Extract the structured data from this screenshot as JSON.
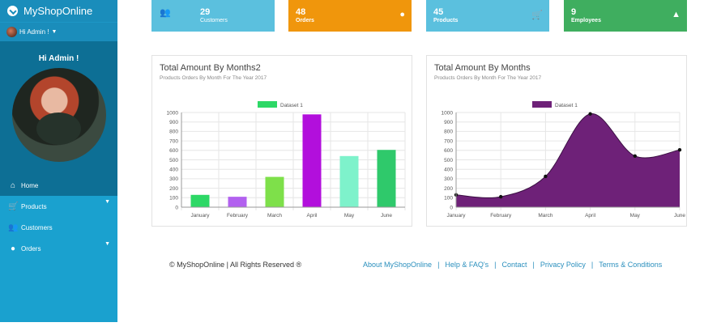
{
  "brand": {
    "title": "MyShopOnline"
  },
  "user": {
    "name": "Hi Admin !"
  },
  "profile": {
    "greeting": "Hi Admin !"
  },
  "nav": [
    {
      "label": "Home",
      "icon": "home-icon"
    },
    {
      "label": "Products",
      "icon": "cart-icon"
    },
    {
      "label": "Customers",
      "icon": "users-icon"
    },
    {
      "label": "Orders",
      "icon": "dollar-icon"
    }
  ],
  "cards": [
    {
      "value": "29",
      "label": "Customers",
      "color": "#5bc0de",
      "icon": "users-icon"
    },
    {
      "value": "48",
      "label": "Orders",
      "color": "#f0960c",
      "icon": "dollar-icon"
    },
    {
      "value": "45",
      "label": "Products",
      "color": "#5bc0de",
      "icon": "cart-icon"
    },
    {
      "value": "9",
      "label": "Employees",
      "color": "#3fae5f",
      "icon": "employee-icon"
    }
  ],
  "chart_data": [
    {
      "type": "bar",
      "title": "Total Amount By Months2",
      "subtitle": "Products Orders By Month For The Year 2017",
      "categories": [
        "January",
        "February",
        "March",
        "April",
        "May",
        "June"
      ],
      "series": [
        {
          "name": "Dataset 1",
          "values": [
            130,
            110,
            320,
            980,
            540,
            605
          ]
        }
      ],
      "colors": [
        "#2dd866",
        "#b261ef",
        "#7ee04a",
        "#b20fdc",
        "#7ef2cb",
        "#2fc96b"
      ],
      "legend_color": "#2dd866",
      "ylim": [
        0,
        1000
      ],
      "yticks": [
        0,
        100,
        200,
        300,
        400,
        500,
        600,
        700,
        800,
        900,
        1000
      ],
      "grid": true,
      "legend": "top-center"
    },
    {
      "type": "area",
      "title": "Total Amount By Months",
      "subtitle": "Products Orders By Month For The Year 2017",
      "categories": [
        "January",
        "February",
        "March",
        "April",
        "May",
        "June"
      ],
      "series": [
        {
          "name": "Dataset 1",
          "values": [
            130,
            110,
            325,
            985,
            540,
            605
          ]
        }
      ],
      "color": "#6e2178",
      "ylim": [
        0,
        1000
      ],
      "yticks": [
        0,
        100,
        200,
        300,
        400,
        500,
        600,
        700,
        800,
        900,
        1000
      ],
      "grid": true,
      "legend": "top-center"
    }
  ],
  "footer": {
    "copyright": "© MyShopOnline | All Rights Reserved ®",
    "links": [
      "About MyShopOnline",
      "Help & FAQ's",
      "Contact",
      "Privacy Policy",
      "Terms & Conditions"
    ]
  }
}
